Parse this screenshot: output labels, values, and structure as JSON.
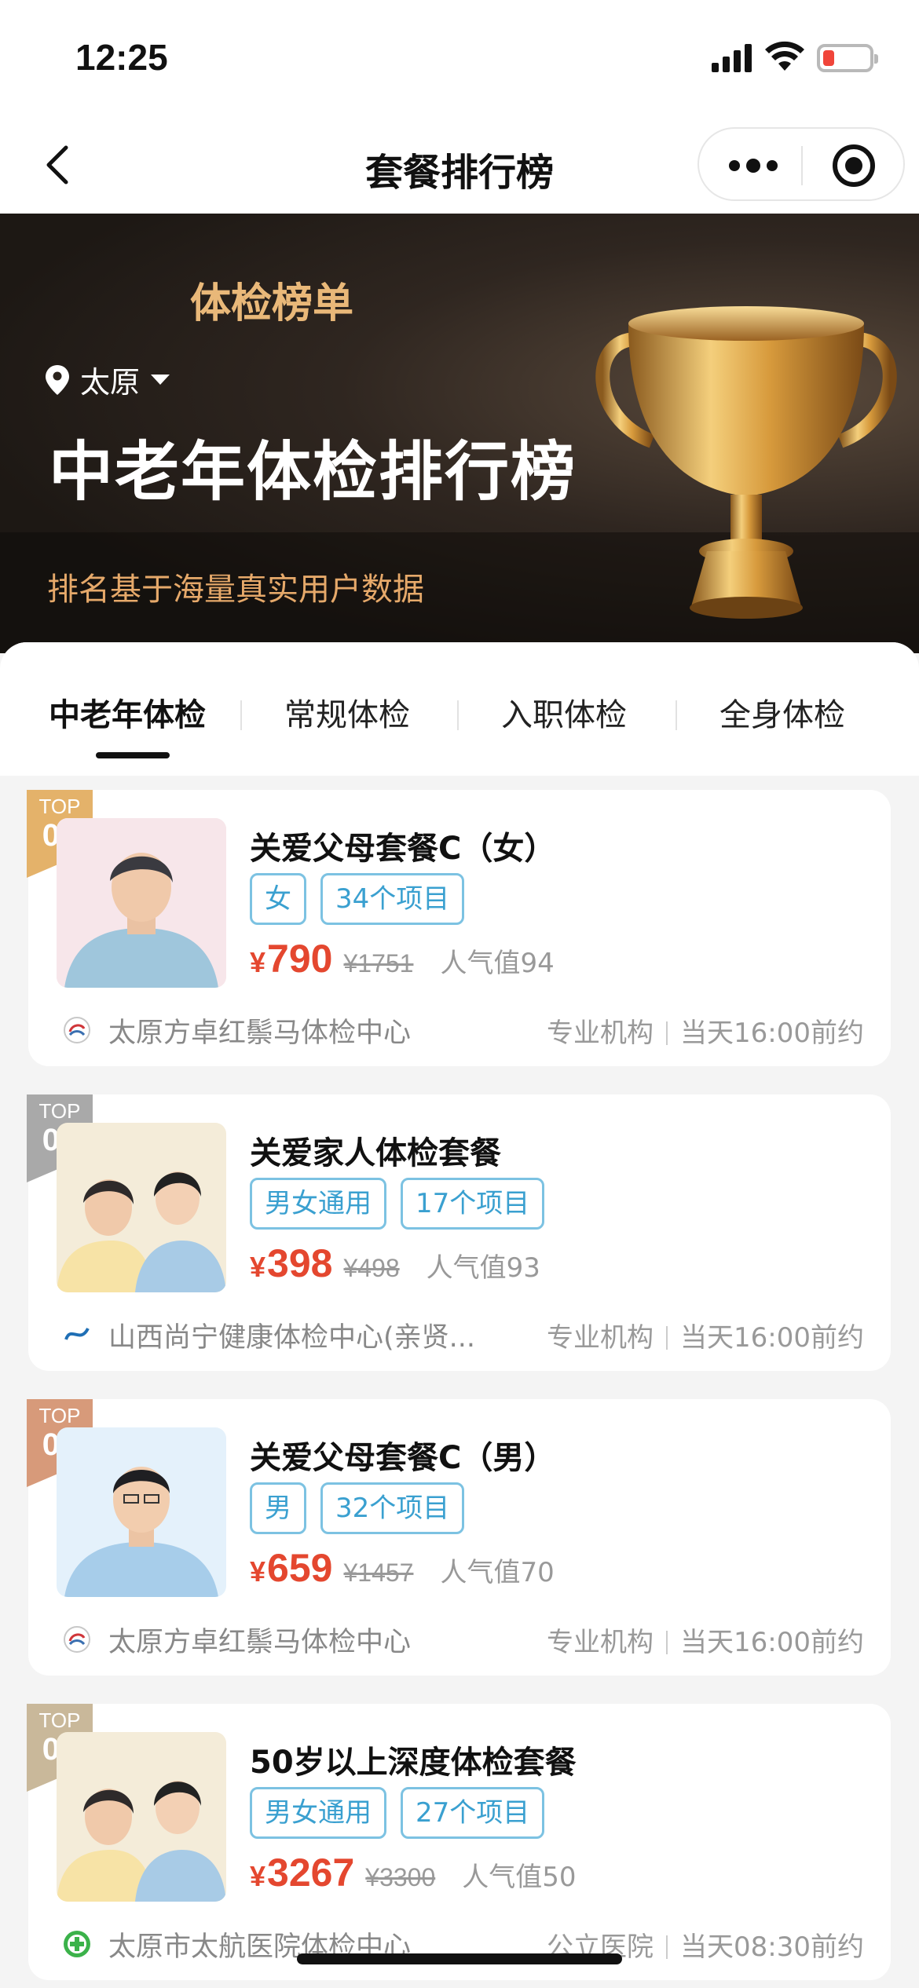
{
  "status": {
    "time": "12:25"
  },
  "nav": {
    "title": "套餐排行榜"
  },
  "banner": {
    "subtitle": "体检榜单",
    "city": "太原",
    "title": "中老年体检排行榜",
    "note": "排名基于海量真实用户数据"
  },
  "tabs": [
    {
      "label": "中老年体检",
      "active": true
    },
    {
      "label": "常规体检",
      "active": false
    },
    {
      "label": "入职体检",
      "active": false
    },
    {
      "label": "全身体检",
      "active": false
    }
  ],
  "cards": [
    {
      "rank_top": "TOP",
      "rank_num": "01",
      "rank_color": "#e4b26a",
      "name": "关爱父母套餐C（女）",
      "tags": [
        "女",
        "34个项目"
      ],
      "currency": "¥",
      "price": "790",
      "old_price": "¥1751",
      "popularity": "人气值94",
      "institution": "太原方卓红鬃马体检中心",
      "inst_type": "专业机构",
      "booking": "当天16:00前约"
    },
    {
      "rank_top": "TOP",
      "rank_num": "02",
      "rank_color": "#a9a9a9",
      "name": "关爱家人体检套餐",
      "tags": [
        "男女通用",
        "17个项目"
      ],
      "currency": "¥",
      "price": "398",
      "old_price": "¥498",
      "popularity": "人气值93",
      "institution": "山西尚宁健康体检中心(亲贤...",
      "inst_type": "专业机构",
      "booking": "当天16:00前约"
    },
    {
      "rank_top": "TOP",
      "rank_num": "03",
      "rank_color": "#d79a7a",
      "name": "关爱父母套餐C（男）",
      "tags": [
        "男",
        "32个项目"
      ],
      "currency": "¥",
      "price": "659",
      "old_price": "¥1457",
      "popularity": "人气值70",
      "institution": "太原方卓红鬃马体检中心",
      "inst_type": "专业机构",
      "booking": "当天16:00前约"
    },
    {
      "rank_top": "TOP",
      "rank_num": "04",
      "rank_color": "#c9b89a",
      "name": "50岁以上深度体检套餐",
      "tags": [
        "男女通用",
        "27个项目"
      ],
      "currency": "¥",
      "price": "3267",
      "old_price": "¥3300",
      "popularity": "人气值50",
      "institution": "太原市太航医院体检中心",
      "inst_type": "公立医院",
      "booking": "当天08:30前约"
    }
  ]
}
